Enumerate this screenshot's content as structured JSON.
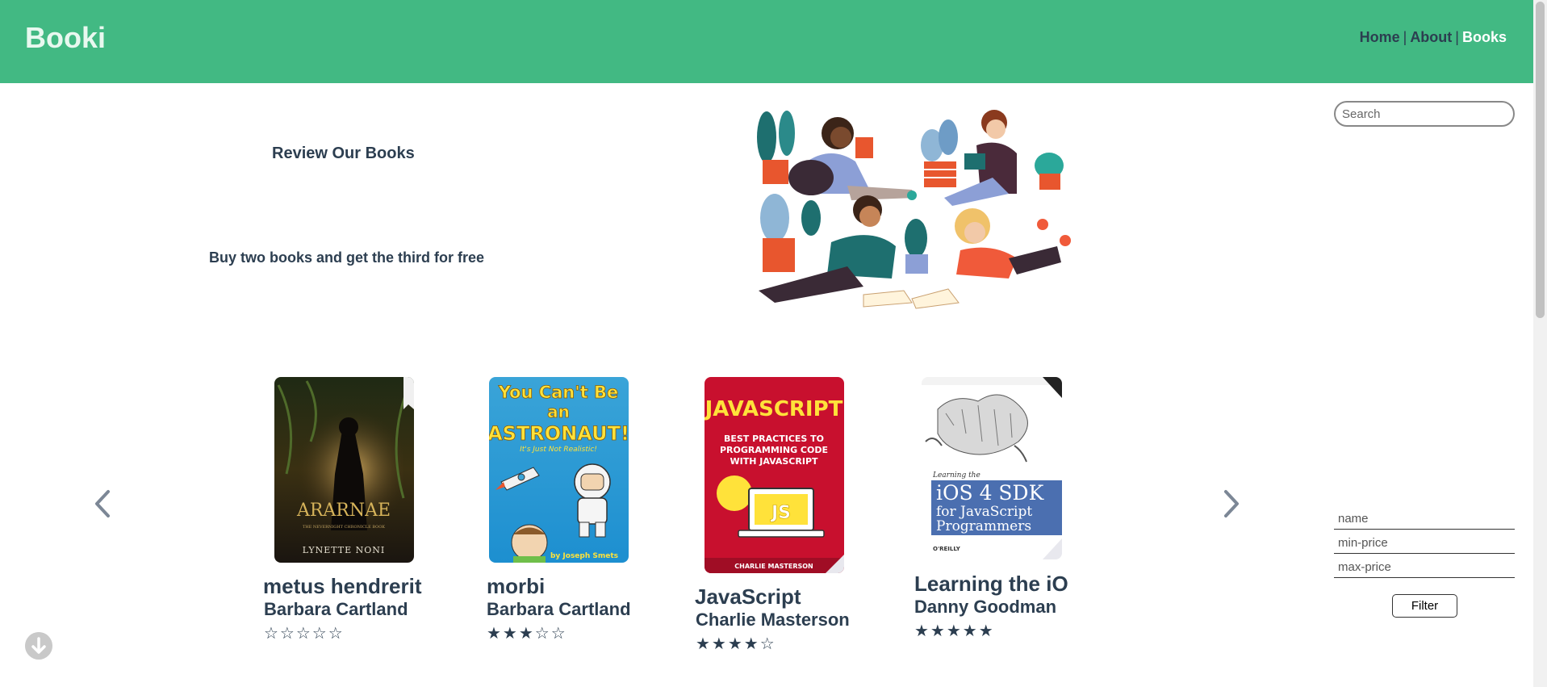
{
  "header": {
    "logo": "Booki",
    "nav": [
      {
        "label": "Home"
      },
      {
        "label": "About"
      },
      {
        "label": "Books"
      }
    ],
    "separator": "|"
  },
  "hero": {
    "title": "Review Our Books",
    "subtitle": "Buy two books and get the third for free"
  },
  "search": {
    "placeholder": "Search"
  },
  "filters": {
    "name_placeholder": "name",
    "min_price_placeholder": "min-price",
    "max_price_placeholder": "max-price",
    "button_label": "Filter"
  },
  "books": [
    {
      "name": "metus hendrerit",
      "author": "Barbara Cartland",
      "stars": "☆☆☆☆☆",
      "rating": 0,
      "cover": {
        "title": "ARARNAE",
        "subtitle": "THE NEVERNIGHT CHRONICLE BOOK",
        "author": "LYNETTE NONI"
      }
    },
    {
      "name": "morbi",
      "author": "Barbara Cartland",
      "stars": "★★★☆☆",
      "rating": 3,
      "cover": {
        "title1": "You Can't Be",
        "title2": "an",
        "title3": "ASTRONAUT!",
        "tag": "It's Just Not Realistic!",
        "author": "by Joseph Smets"
      }
    },
    {
      "name": "JavaScript",
      "author": "Charlie Masterson",
      "stars": "★★★★☆",
      "rating": 4,
      "cover": {
        "title": "JAVASCRIPT",
        "sub1": "BEST PRACTICES TO",
        "sub2": "PROGRAMMING CODE",
        "sub3": "WITH JAVASCRIPT",
        "badge": "JS",
        "author": "CHARLIE MASTERSON"
      }
    },
    {
      "name": "Learning the iO",
      "author": "Danny Goodman",
      "stars": "★★★★★",
      "rating": 5,
      "cover": {
        "pre": "Learning the",
        "title1": "iOS 4 SDK",
        "title2": "for JavaScript",
        "title3": "Programmers",
        "publisher": "O'REILLY"
      }
    }
  ],
  "colors": {
    "header": "#42b983",
    "text": "#2c3e50",
    "accent_white": "#ffffff"
  }
}
